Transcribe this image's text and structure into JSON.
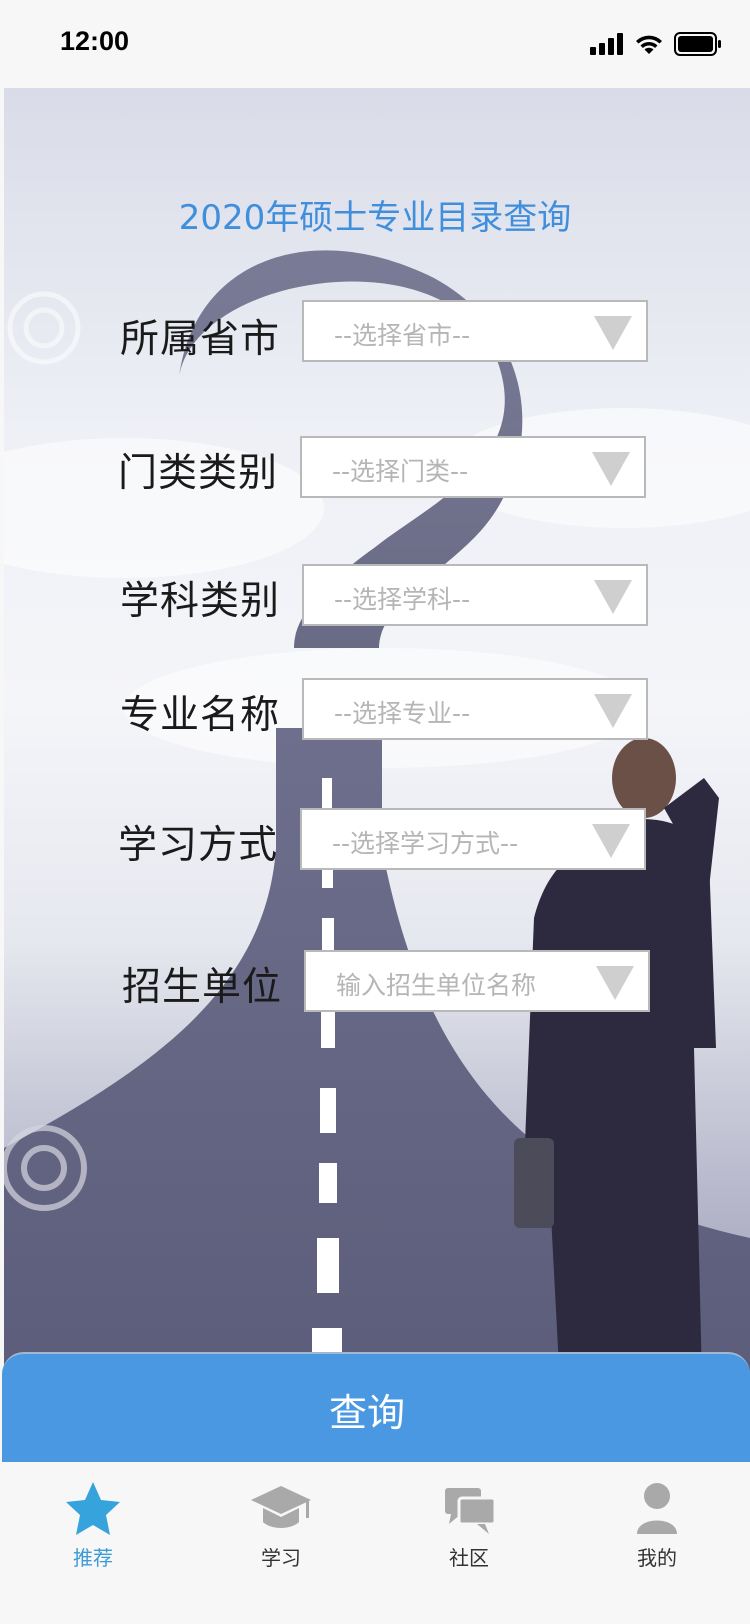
{
  "status_bar": {
    "time": "12:00"
  },
  "form": {
    "title": "2020年硕士专业目录查询",
    "fields": [
      {
        "label": "所属省市",
        "placeholder": "--选择省市--"
      },
      {
        "label": "门类类别",
        "placeholder": "--选择门类--"
      },
      {
        "label": "学科类别",
        "placeholder": "--选择学科--"
      },
      {
        "label": "专业名称",
        "placeholder": "--选择专业--"
      },
      {
        "label": "学习方式",
        "placeholder": "--选择学习方式--"
      },
      {
        "label": "招生单位",
        "placeholder": "输入招生单位名称"
      }
    ]
  },
  "query_button": {
    "label": "查询"
  },
  "tab_bar": {
    "tabs": [
      {
        "label": "推荐",
        "icon": "star-icon",
        "active": true
      },
      {
        "label": "学习",
        "icon": "graduation-cap-icon",
        "active": false
      },
      {
        "label": "社区",
        "icon": "chat-bubbles-icon",
        "active": false
      },
      {
        "label": "我的",
        "icon": "user-icon",
        "active": false
      }
    ]
  },
  "colors": {
    "accent": "#4a98e1",
    "title": "#3f8fdc",
    "active_tab": "#3b9bd8",
    "inactive_tab_icon": "#a9a9a9"
  }
}
